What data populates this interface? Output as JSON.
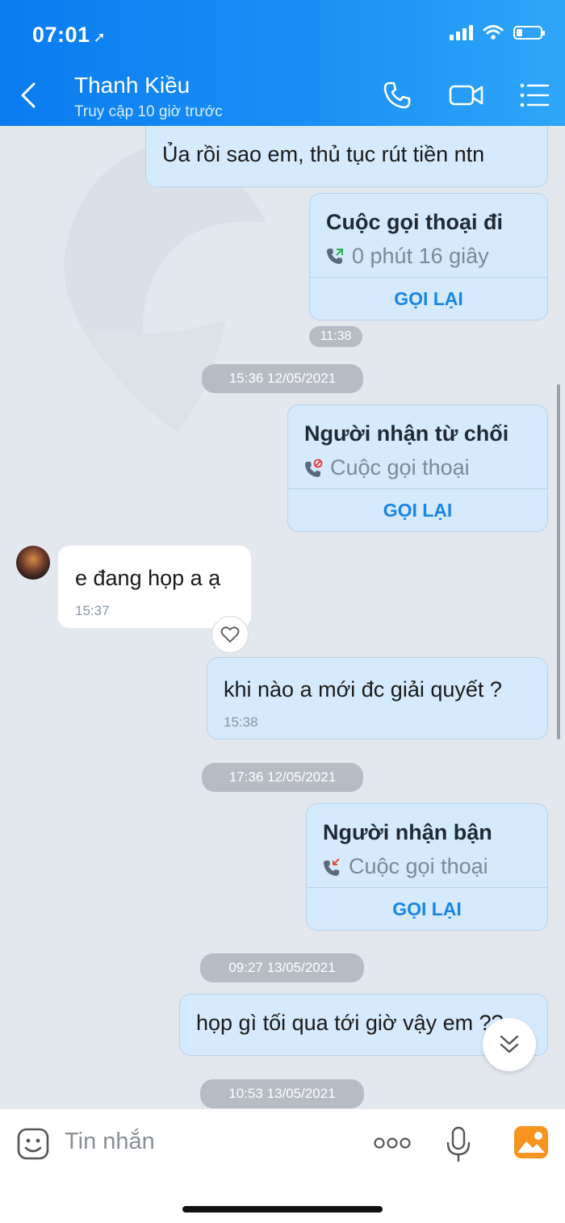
{
  "status_bar": {
    "time": "07:01"
  },
  "header": {
    "contact_name": "Thanh Kiều",
    "last_seen": "Truy cập 10 giờ trước"
  },
  "messages": {
    "m1": {
      "text": "Ủa rồi sao em, thủ tục rút tiền ntn"
    },
    "call1": {
      "title": "Cuộc gọi thoại đi",
      "subtitle": "0 phút 16 giây",
      "action": "GỌI LẠI",
      "time": "11:38"
    },
    "sep1": "15:36 12/05/2021",
    "call2": {
      "title": "Người nhận từ chối",
      "subtitle": "Cuộc gọi thoại",
      "action": "GỌI LẠI"
    },
    "m2": {
      "text": "e đang họp a ạ",
      "time": "15:37"
    },
    "m3": {
      "text": "khi nào a mới đc giải quyết ?",
      "time": "15:38"
    },
    "sep2": "17:36 12/05/2021",
    "call3": {
      "title": "Người nhận bận",
      "subtitle": "Cuộc gọi thoại",
      "action": "GỌI LẠI"
    },
    "sep3": "09:27 13/05/2021",
    "m4": {
      "text": "họp gì tối qua tới giờ vậy em ??"
    },
    "sep4": "10:53 13/05/2021"
  },
  "composer": {
    "placeholder": "Tin nhắn"
  },
  "colors": {
    "header_start": "#0a7cf0",
    "header_end": "#2ea6f8",
    "accent": "#1985e6",
    "outgoing_bubble": "#d5eafc"
  }
}
